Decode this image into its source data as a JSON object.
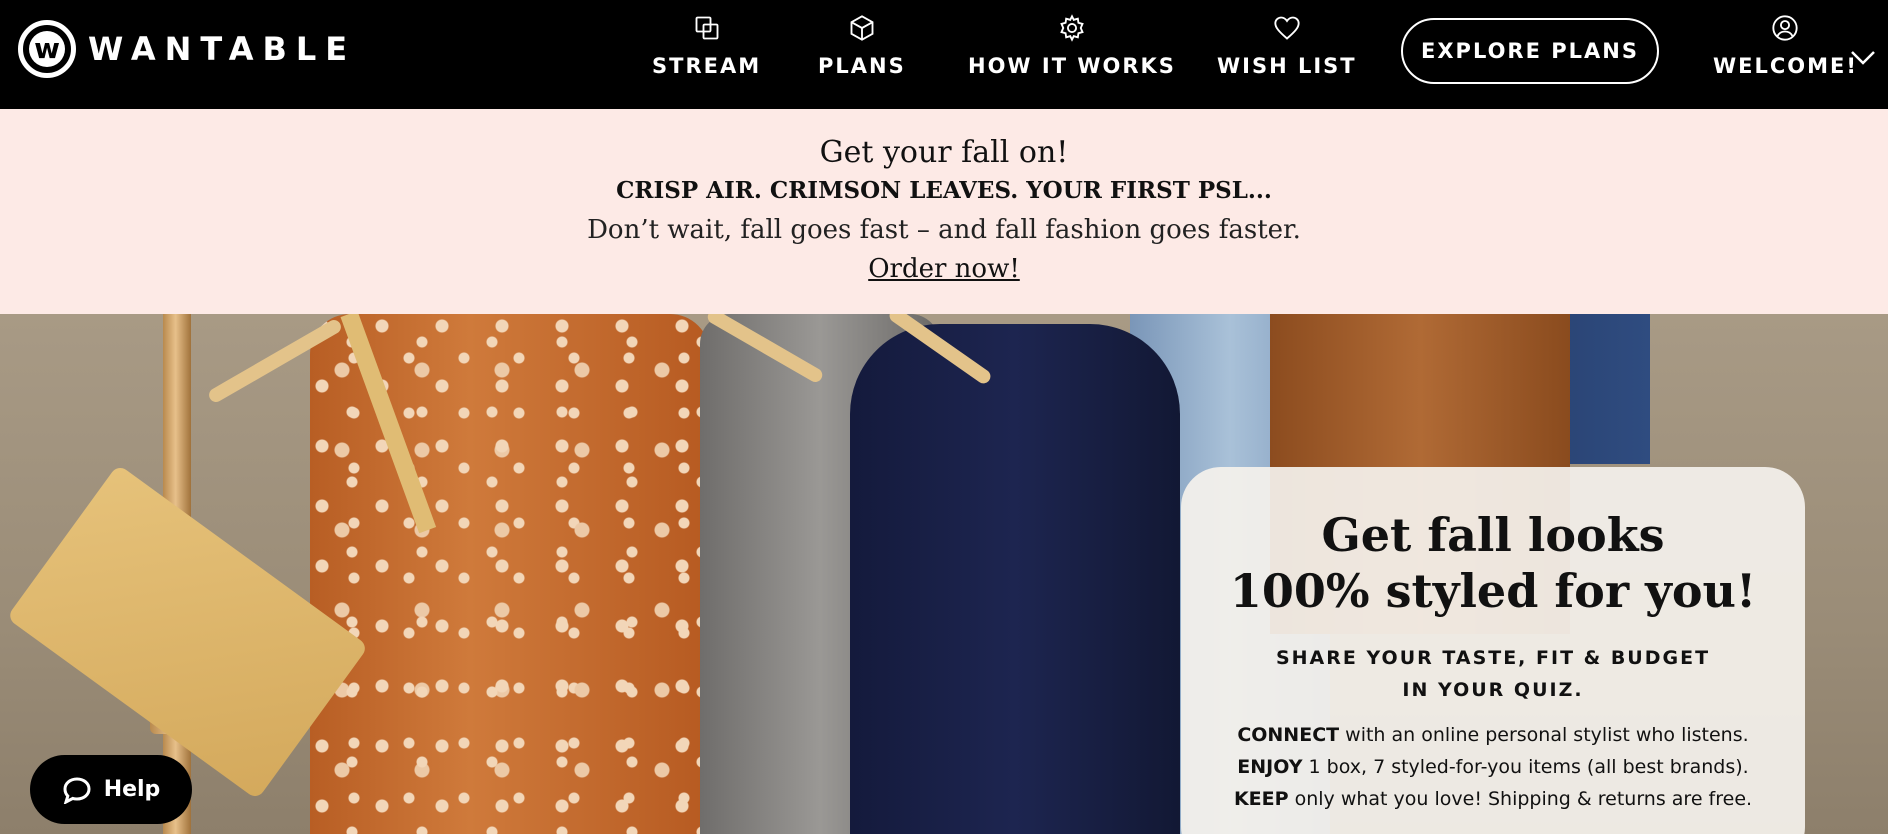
{
  "brand": {
    "name": "WANTABLE",
    "logo_letter": "w"
  },
  "nav": {
    "items": [
      {
        "label": "STREAM",
        "icon": "stream-icon"
      },
      {
        "label": "PLANS",
        "icon": "box-icon"
      },
      {
        "label": "HOW IT WORKS",
        "icon": "gear-icon"
      },
      {
        "label": "WISH LIST",
        "icon": "heart-icon"
      }
    ],
    "cta": "EXPLORE PLANS",
    "account": {
      "label": "WELCOME!",
      "icon": "user-icon"
    }
  },
  "promo": {
    "title": "Get your fall on!",
    "subtitle": "CRISP AIR. CRIMSON LEAVES. YOUR FIRST PSL...",
    "text": "Don’t wait, fall goes fast – and fall fashion goes faster.",
    "link": "Order now!"
  },
  "hero": {
    "card": {
      "title_line1": "Get fall looks",
      "title_line2": "100% styled for you!",
      "subtitle_line1": "SHARE YOUR TASTE, FIT & BUDGET",
      "subtitle_line2": "IN YOUR QUIZ.",
      "lines": [
        {
          "bold": "CONNECT",
          "text": " with an online personal stylist who listens."
        },
        {
          "bold": "ENJOY",
          "text": " 1 box, 7 styled-for-you items (all best brands)."
        },
        {
          "bold": "KEEP",
          "text": " only what you love! Shipping & returns are free."
        }
      ]
    }
  },
  "help": {
    "label": "Help"
  }
}
